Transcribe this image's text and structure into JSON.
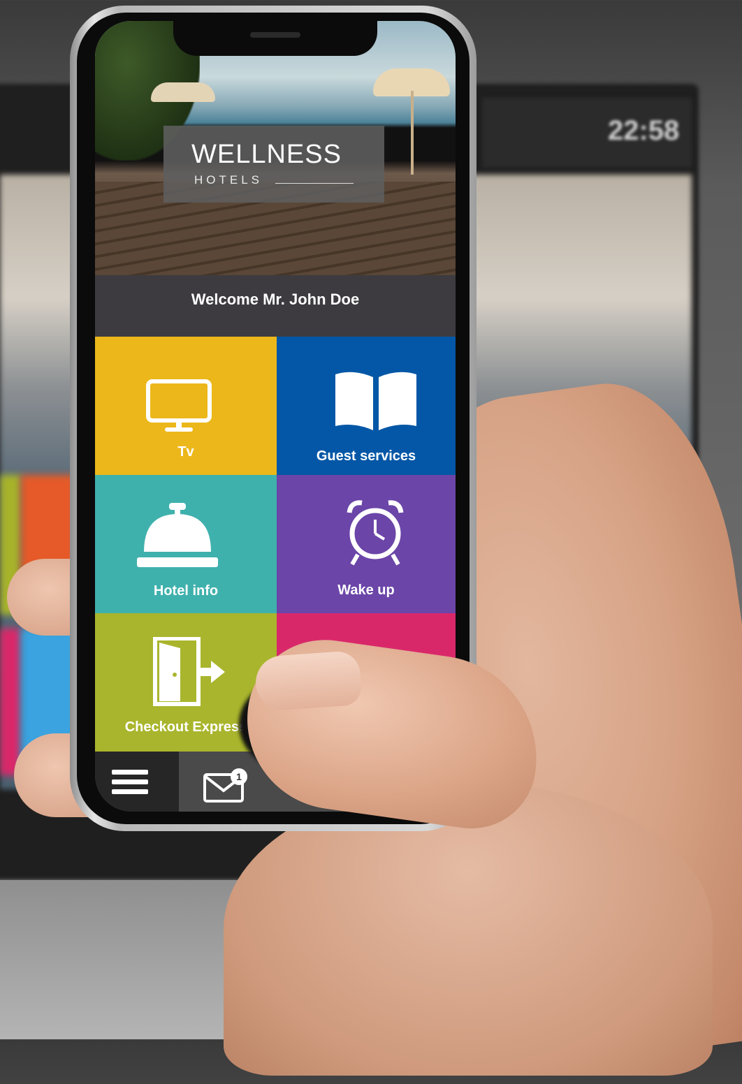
{
  "background": {
    "tv_clock": "22:58"
  },
  "app": {
    "brand": {
      "title": "WELLNESS",
      "subtitle": "HOTELS"
    },
    "welcome": "Welcome Mr. John Doe",
    "tiles": [
      {
        "label": "Tv",
        "icon": "tv-icon",
        "color": "#ecb71a"
      },
      {
        "label": "Guest services",
        "icon": "book-icon",
        "color": "#0457a6"
      },
      {
        "label": "Hotel info",
        "icon": "service-bell-icon",
        "color": "#3fb1ad"
      },
      {
        "label": "Wake up",
        "icon": "alarm-clock-icon",
        "color": "#6b45a8"
      },
      {
        "label": "Checkout Express",
        "icon": "exit-door-icon",
        "color": "#a9b52c"
      },
      {
        "label": "",
        "icon": "",
        "color": "#d9286a"
      }
    ],
    "bottom_bar": {
      "menu_icon": "hamburger-menu-icon",
      "mail_icon": "mail-icon",
      "mail_badge": "1"
    }
  }
}
